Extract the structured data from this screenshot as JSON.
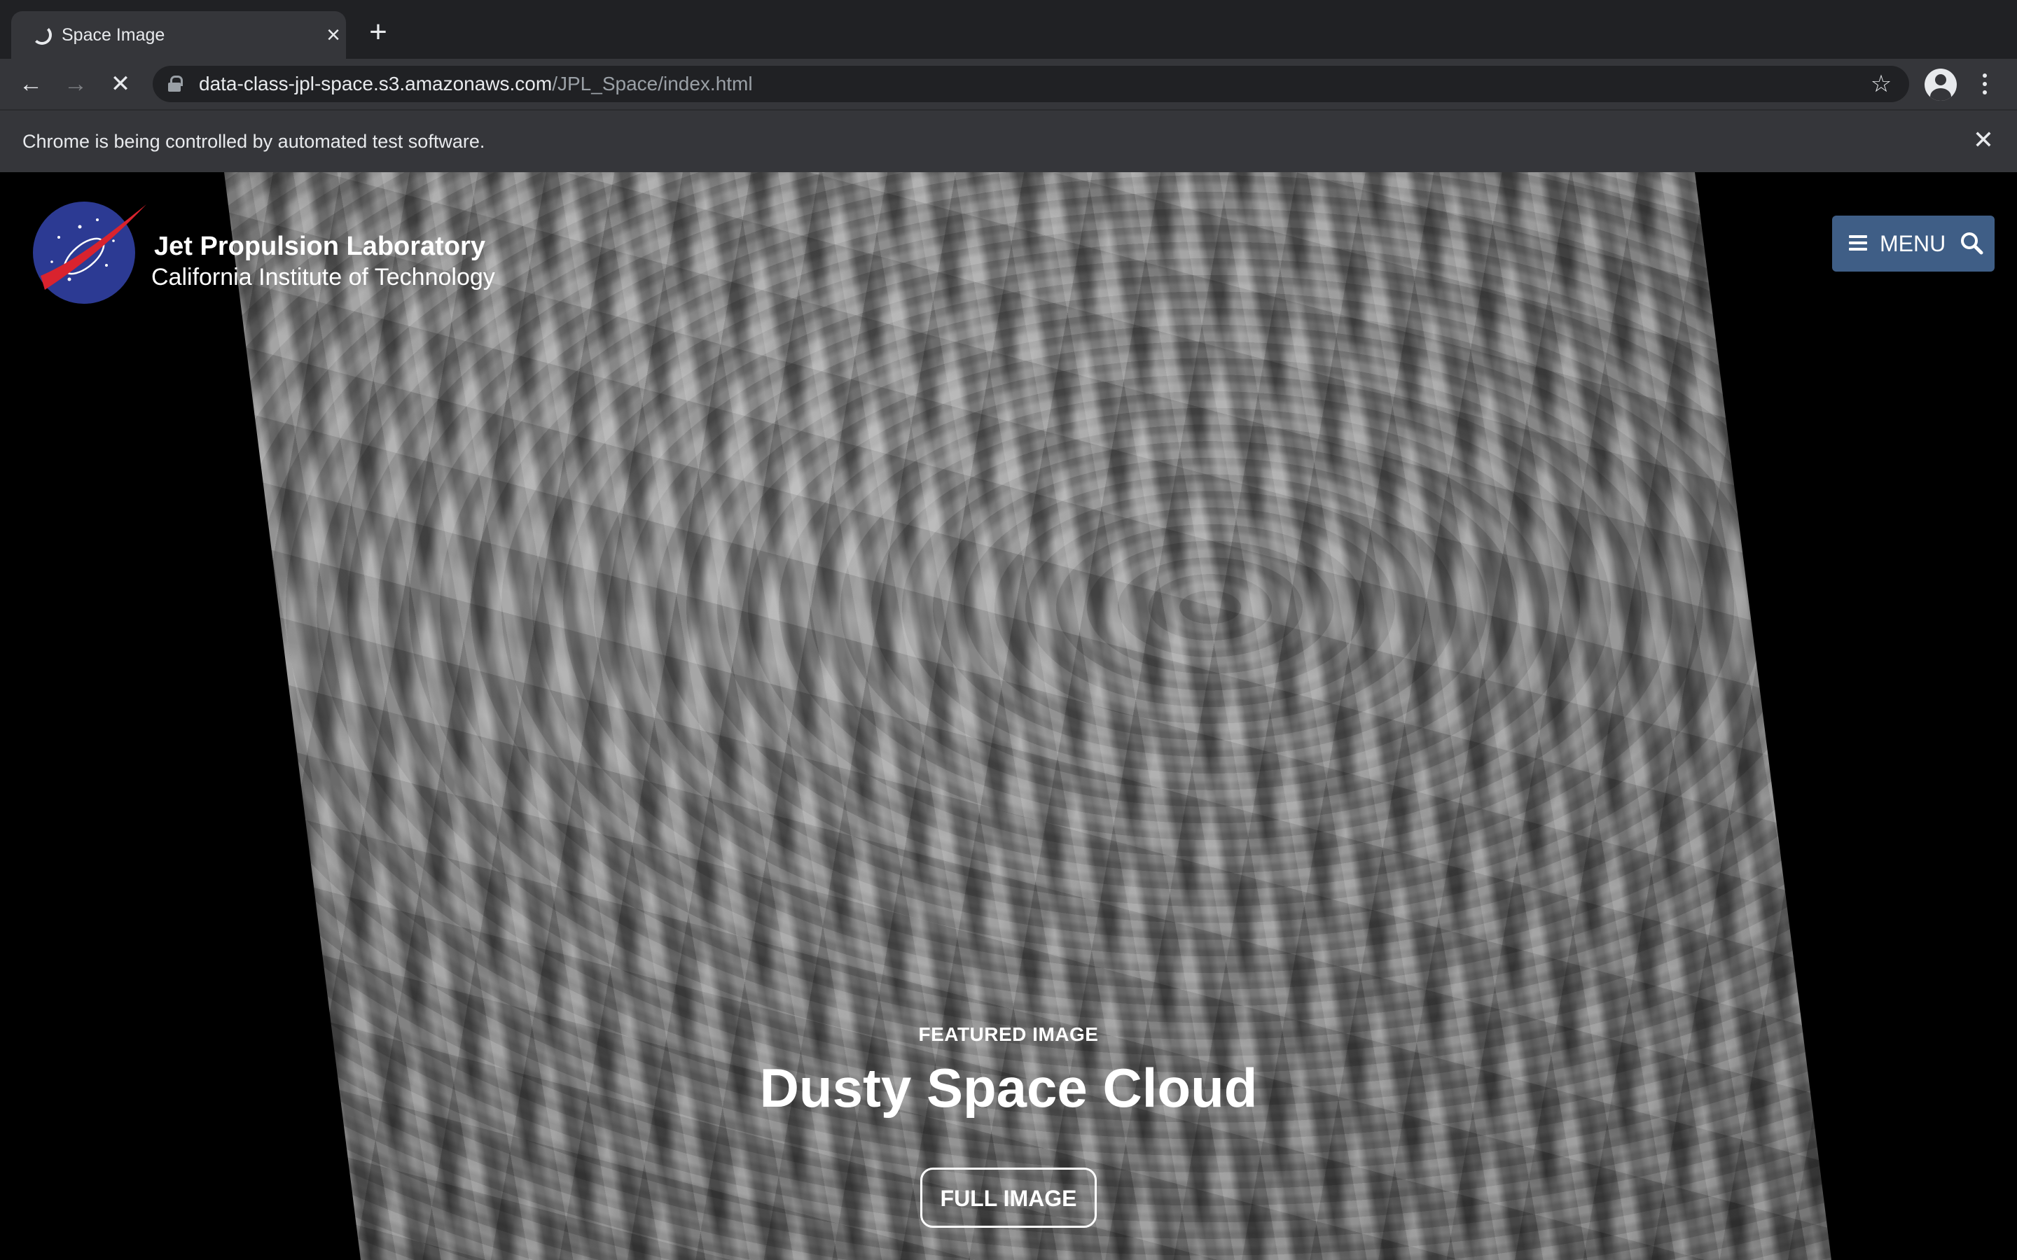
{
  "browser": {
    "tab_title": "Space Image",
    "tab_close_glyph": "×",
    "new_tab_glyph": "+",
    "back_glyph": "←",
    "forward_glyph": "→",
    "stop_glyph": "✕",
    "url_host": "data-class-jpl-space.s3.amazonaws.com",
    "url_path": "/JPL_Space/index.html",
    "star_glyph": "☆",
    "infobar_text": "Chrome is being controlled by automated test software.",
    "infobar_close_glyph": "✕"
  },
  "header": {
    "lab_name": "Jet Propulsion Laboratory",
    "lab_subtitle": "California Institute of Technology",
    "menu_label": "MENU"
  },
  "hero": {
    "featured_label": "FEATURED IMAGE",
    "title": "Dusty Space Cloud",
    "full_image_button": "FULL IMAGE"
  },
  "icons": {
    "logo": "nasa-meatball-logo-icon",
    "menu": "hamburger-icon",
    "search": "search-icon",
    "lock": "lock-icon",
    "profile": "profile-icon",
    "kebab": "more-vert-icon"
  },
  "colors": {
    "tabstrip": "#202124",
    "toolbar": "#35363a",
    "menu_button": "#3f5e86",
    "page_background": "#000000"
  }
}
